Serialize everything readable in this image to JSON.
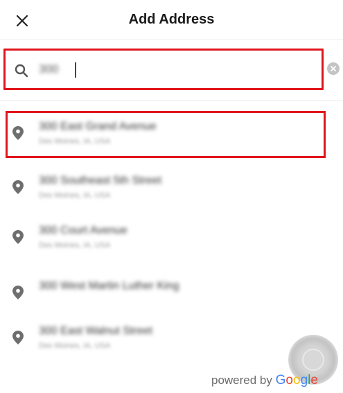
{
  "header": {
    "title": "Add Address",
    "close_icon": "close-icon"
  },
  "search": {
    "value": "300",
    "placeholder": "",
    "search_icon": "search-icon",
    "clear_icon": "clear-icon"
  },
  "results": [
    {
      "main": "300 East Grand Avenue",
      "sub": "Des Moines, IA, USA",
      "selected": true
    },
    {
      "main": "300 Southeast 5th Street",
      "sub": "Des Moines, IA, USA",
      "selected": false
    },
    {
      "main": "300 Court Avenue",
      "sub": "Des Moines, IA, USA",
      "selected": false
    },
    {
      "main": "300 West Martin Luther King",
      "sub": "",
      "selected": false
    },
    {
      "main": "300 East Walnut Street",
      "sub": "Des Moines, IA, USA",
      "selected": false
    }
  ],
  "footer": {
    "powered_by": "powered by",
    "google_letters": [
      "G",
      "o",
      "o",
      "g",
      "l",
      "e"
    ]
  },
  "colors": {
    "highlight": "#e0161d",
    "pin": "#6e6e6e"
  }
}
